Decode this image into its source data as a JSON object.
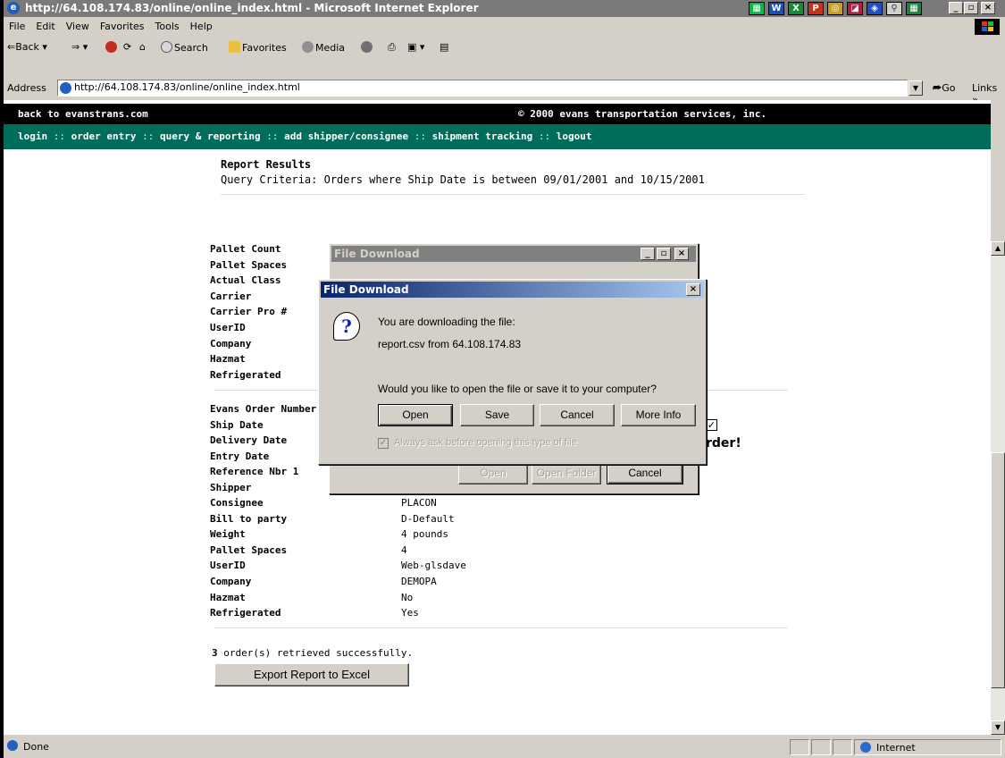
{
  "window": {
    "title": "http://64.108.174.83/online/online_index.html - Microsoft Internet Explorer"
  },
  "menu": [
    "File",
    "Edit",
    "View",
    "Favorites",
    "Tools",
    "Help"
  ],
  "toolbar": {
    "back": "Back",
    "search": "Search",
    "favorites": "Favorites",
    "media": "Media"
  },
  "address": {
    "label": "Address",
    "url": "http://64.108.174.83/online/online_index.html",
    "go": "Go",
    "links": "Links"
  },
  "site": {
    "back_link": "back to evanstrans.com",
    "copyright": "© 2000 evans transportation services, inc.",
    "nav": [
      "login",
      "order entry",
      "query & reporting",
      "add shipper/consignee",
      "shipment tracking",
      "logout"
    ],
    "nav_sep": "::"
  },
  "report": {
    "heading": "Report Results",
    "criteria": "Query Criteria: Orders where Ship Date is between 09/01/2001 and 10/15/2001",
    "block1_labels": [
      "Pallet Count",
      "Pallet Spaces",
      "Actual Class",
      "Carrier",
      "Carrier Pro #",
      "UserID",
      "Company",
      "Hazmat",
      "Refrigerated"
    ],
    "block2_labels": [
      "Evans Order Number",
      "Ship Date",
      "Delivery Date",
      "Entry Date",
      "Reference Nbr 1",
      "Shipper"
    ],
    "block2_fields": [
      {
        "label": "Consignee",
        "value": "PLACON"
      },
      {
        "label": "Bill to party",
        "value": "D-Default"
      },
      {
        "label": "Weight",
        "value": "4 pounds"
      },
      {
        "label": "Pallet Spaces",
        "value": "4"
      },
      {
        "label": "UserID",
        "value": "Web-glsdave"
      },
      {
        "label": "Company",
        "value": "DEMOPA"
      },
      {
        "label": "Hazmat",
        "value": "No"
      },
      {
        "label": "Refrigerated",
        "value": "Yes"
      }
    ],
    "partial_text": "rder!",
    "summary_count": "3",
    "summary_text": "order(s) retrieved successfully.",
    "export_label": "Export Report to Excel"
  },
  "dialog_back": {
    "title": "File Download",
    "buttons": [
      "Open",
      "Open Folder",
      "Cancel"
    ]
  },
  "dialog_front": {
    "title": "File Download",
    "line1": "You are downloading the file:",
    "line2": "report.csv from 64.108.174.83",
    "question": "Would you like to open the file or save it to your computer?",
    "buttons": [
      "Open",
      "Save",
      "Cancel",
      "More Info"
    ],
    "checkbox_label": "Always ask before opening this type of file",
    "checkbox_checked": true
  },
  "status": {
    "left": "Done",
    "zone": "Internet"
  },
  "colors": {
    "title_active": "#0a246a",
    "title_inactive": "#7a7a7a",
    "nav_band": "#006c5a"
  }
}
